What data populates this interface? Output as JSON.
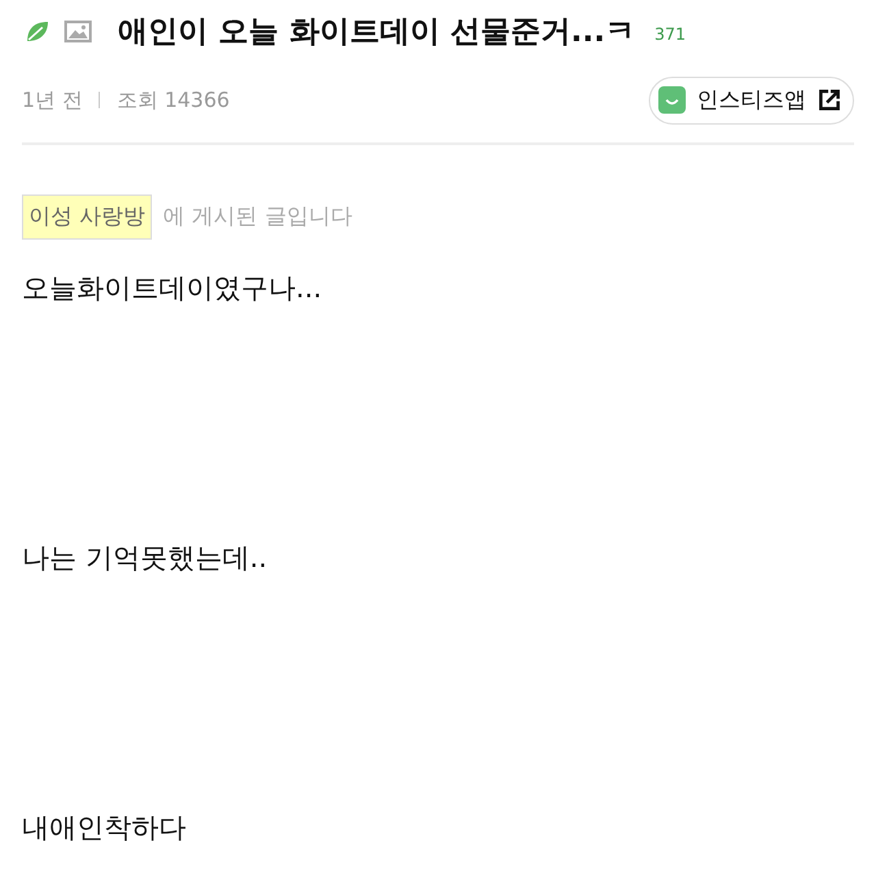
{
  "post": {
    "title": "애인이 오늘 화이트데이 선물준거...ㅋ",
    "comment_count": "371",
    "age": "1년 전",
    "views": "조회 14366",
    "app_button": "인스티즈앱"
  },
  "board": {
    "name": "이성 사랑방",
    "suffix": "에 게시된 글입니다"
  },
  "paragraphs": [
    "오늘화이트데이였구나...",
    "나는 기억못했는데..",
    "내애인착하다"
  ]
}
